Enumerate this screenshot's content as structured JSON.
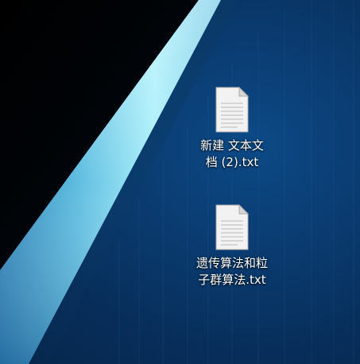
{
  "desktop": {
    "icons": [
      {
        "name": "new-text-document-2",
        "type_icon": "text-file-icon",
        "label_line1": "新建 文本文",
        "label_line2": "档 (2).txt"
      },
      {
        "name": "genetic-pso-algorithm",
        "type_icon": "text-file-icon",
        "label_line1": "遗传算法和粒",
        "label_line2": "子群算法.txt"
      }
    ],
    "colors": {
      "background": "#0a3b70",
      "stripe_light": "#9fe2f4",
      "stripe_dark": "#000000"
    }
  }
}
